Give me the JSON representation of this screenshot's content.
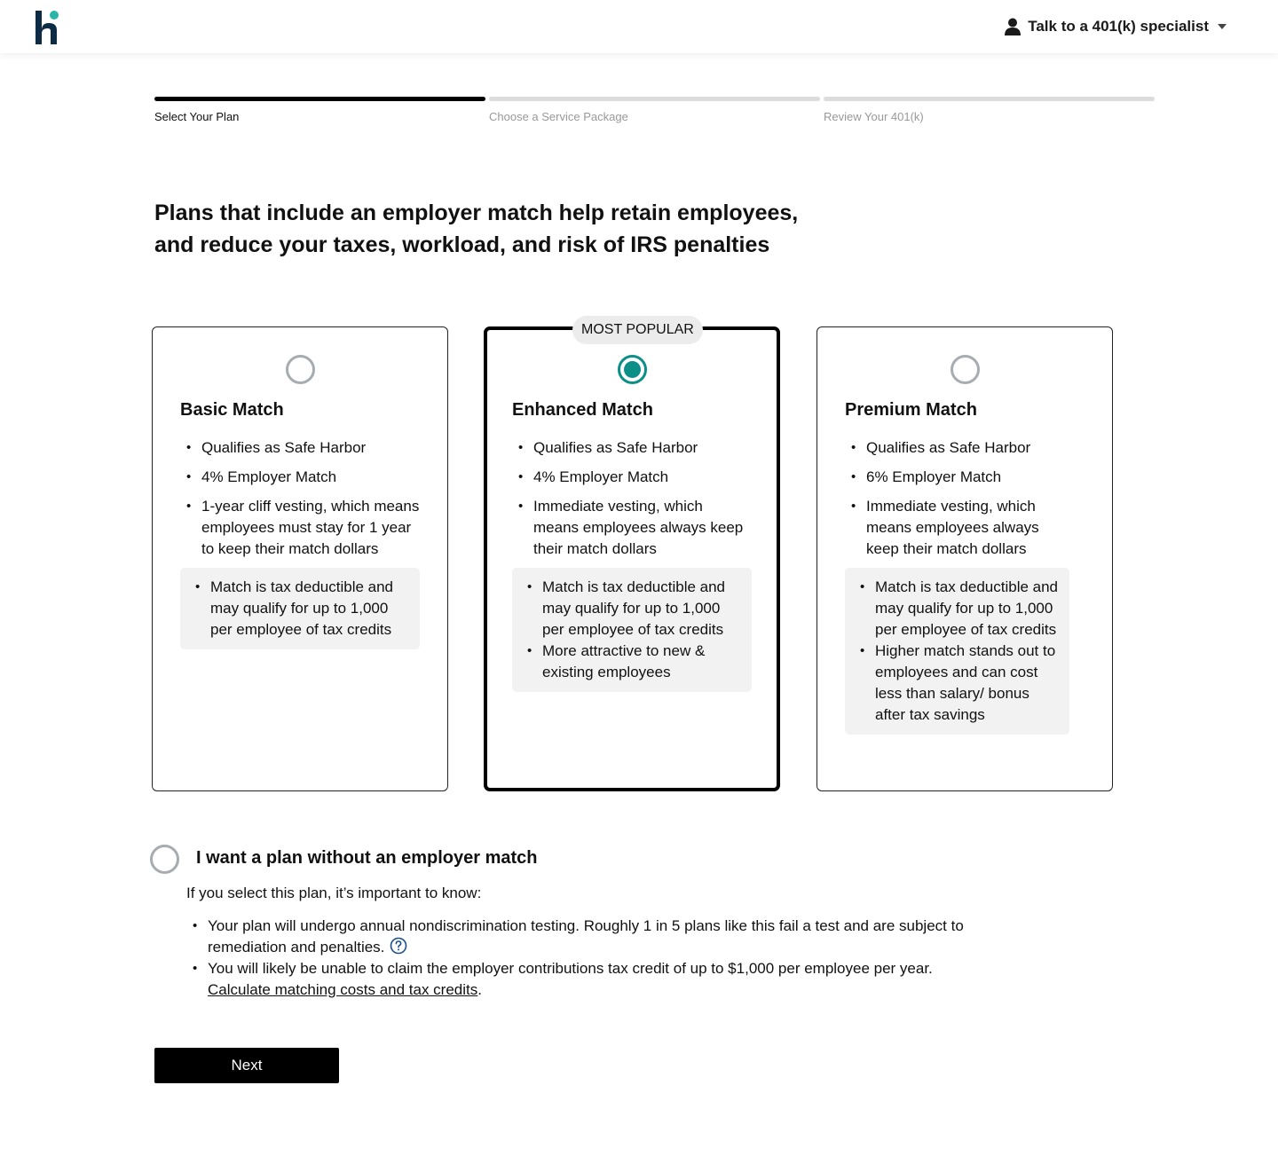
{
  "header": {
    "logo_icon": "hi-logo-icon",
    "specialist_label": "Talk to a 401(k) specialist",
    "person_icon": "person-icon",
    "caret_icon": "chevron-down-icon"
  },
  "progress": {
    "steps": [
      {
        "label": "Select Your Plan",
        "active": true
      },
      {
        "label": "Choose a Service Package",
        "active": false
      },
      {
        "label": "Review Your 401(k)",
        "active": false
      }
    ]
  },
  "headline": {
    "line1": "Plans that include an employer match help retain employees,",
    "line2": "and reduce your taxes, workload, and risk of IRS penalties"
  },
  "plans": [
    {
      "title": "Basic Match",
      "selected": false,
      "features": [
        "Qualifies as Safe Harbor",
        "4% Employer Match",
        "1-year cliff vesting, which means employees must stay for 1 year to keep their match dollars"
      ],
      "benefits": [
        "Match is tax deductible and may qualify for up to 1,000 per employee of tax credits"
      ]
    },
    {
      "title": "Enhanced Match",
      "badge": "MOST POPULAR",
      "selected": true,
      "features": [
        "Qualifies as Safe Harbor",
        "4% Employer Match",
        "Immediate vesting, which means employees always keep their match dollars"
      ],
      "benefits": [
        "Match is tax deductible and may qualify for up to 1,000 per employee of tax credits",
        "More attractive to new & existing employees"
      ]
    },
    {
      "title": "Premium Match",
      "selected": false,
      "features": [
        "Qualifies as Safe Harbor",
        "6% Employer Match",
        "Immediate vesting, which means employees always keep their match dollars"
      ],
      "benefits": [
        "Match is tax deductible and may qualify for up to 1,000 per employee of tax credits",
        "Higher match stands out to employees and can cost less than salary/ bonus after tax savings"
      ]
    }
  ],
  "no_match": {
    "title": "I want a plan without an employer match",
    "selected": false,
    "intro": "If you select this plan, it’s important to know:",
    "bullet1": "Your plan will undergo annual nondiscrimination testing. Roughly 1 in 5 plans like this fail a test and are subject to remediation and penalties.",
    "help_icon": "question-circle-icon",
    "bullet2": "You will likely be unable to claim the employer contributions tax credit of up to $1,000 per employee per year.",
    "link_text": "Calculate matching costs and tax credits",
    "link_suffix": "."
  },
  "next_label": "Next",
  "colors": {
    "accent": "#0b8f86",
    "logo_dark": "#0d2b45",
    "logo_dot": "#2bb5a9",
    "radio_unselected": "#a7acb1",
    "benefit_bg": "#f2f2f2"
  }
}
